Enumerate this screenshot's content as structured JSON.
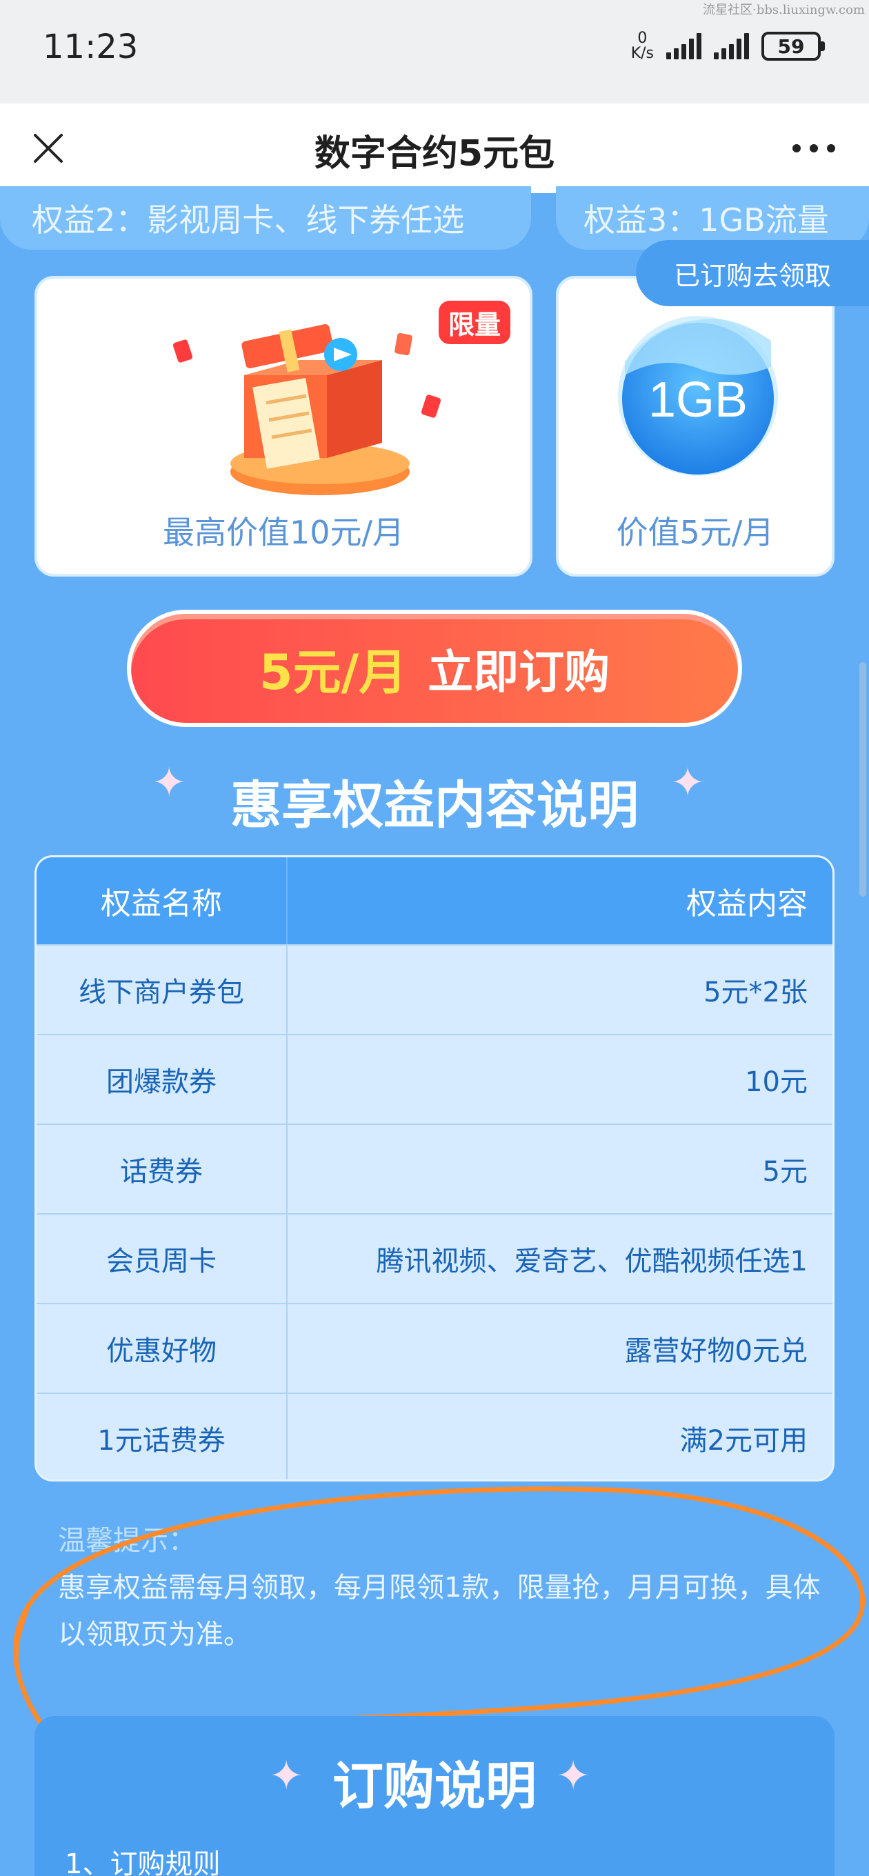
{
  "status_bar": {
    "time": "11:23",
    "net_speed_value": "0",
    "net_speed_unit": "K/s",
    "battery": "59",
    "watermark": "流星社区·bbs.liuxingw.com"
  },
  "nav": {
    "title": "数字合约5元包",
    "close_icon": "close-icon",
    "more_icon": "more-icon"
  },
  "benefit_pills": {
    "left": "权益2：影视周卡、线下券任选",
    "right": "权益3：1GB流量",
    "ordered_button": "已订购去领取"
  },
  "cards": {
    "left_tag": "限量",
    "left_caption": "最高价值10元/月",
    "right_badge": "1GB",
    "right_caption": "价值5元/月"
  },
  "cta": {
    "price": "5元/月",
    "label": "立即订购"
  },
  "section_title": "惠享权益内容说明",
  "table": {
    "headers": [
      "权益名称",
      "权益内容"
    ],
    "rows": [
      [
        "线下商户券包",
        "5元*2张"
      ],
      [
        "团爆款券",
        "10元"
      ],
      [
        "话费券",
        "5元"
      ],
      [
        "会员周卡",
        "腾讯视频、爱奇艺、优酷视频任选1"
      ],
      [
        "优惠好物",
        "露营好物0元兑"
      ],
      [
        "1元话费券",
        "满2元可用"
      ]
    ]
  },
  "tips": {
    "title": "温馨提示：",
    "body": "惠享权益需每月领取，每月限领1款，限量抢，月月可换，具体以领取页为准。"
  },
  "order_section": {
    "title": "订购说明",
    "rule_1": "1、订购规则"
  },
  "colors": {
    "page_bg": "#61aef6",
    "cta_start": "#ff4a4f",
    "cta_end": "#ff7a4a",
    "cta_price": "#ffe24a",
    "annotation": "#ff8a2a"
  }
}
